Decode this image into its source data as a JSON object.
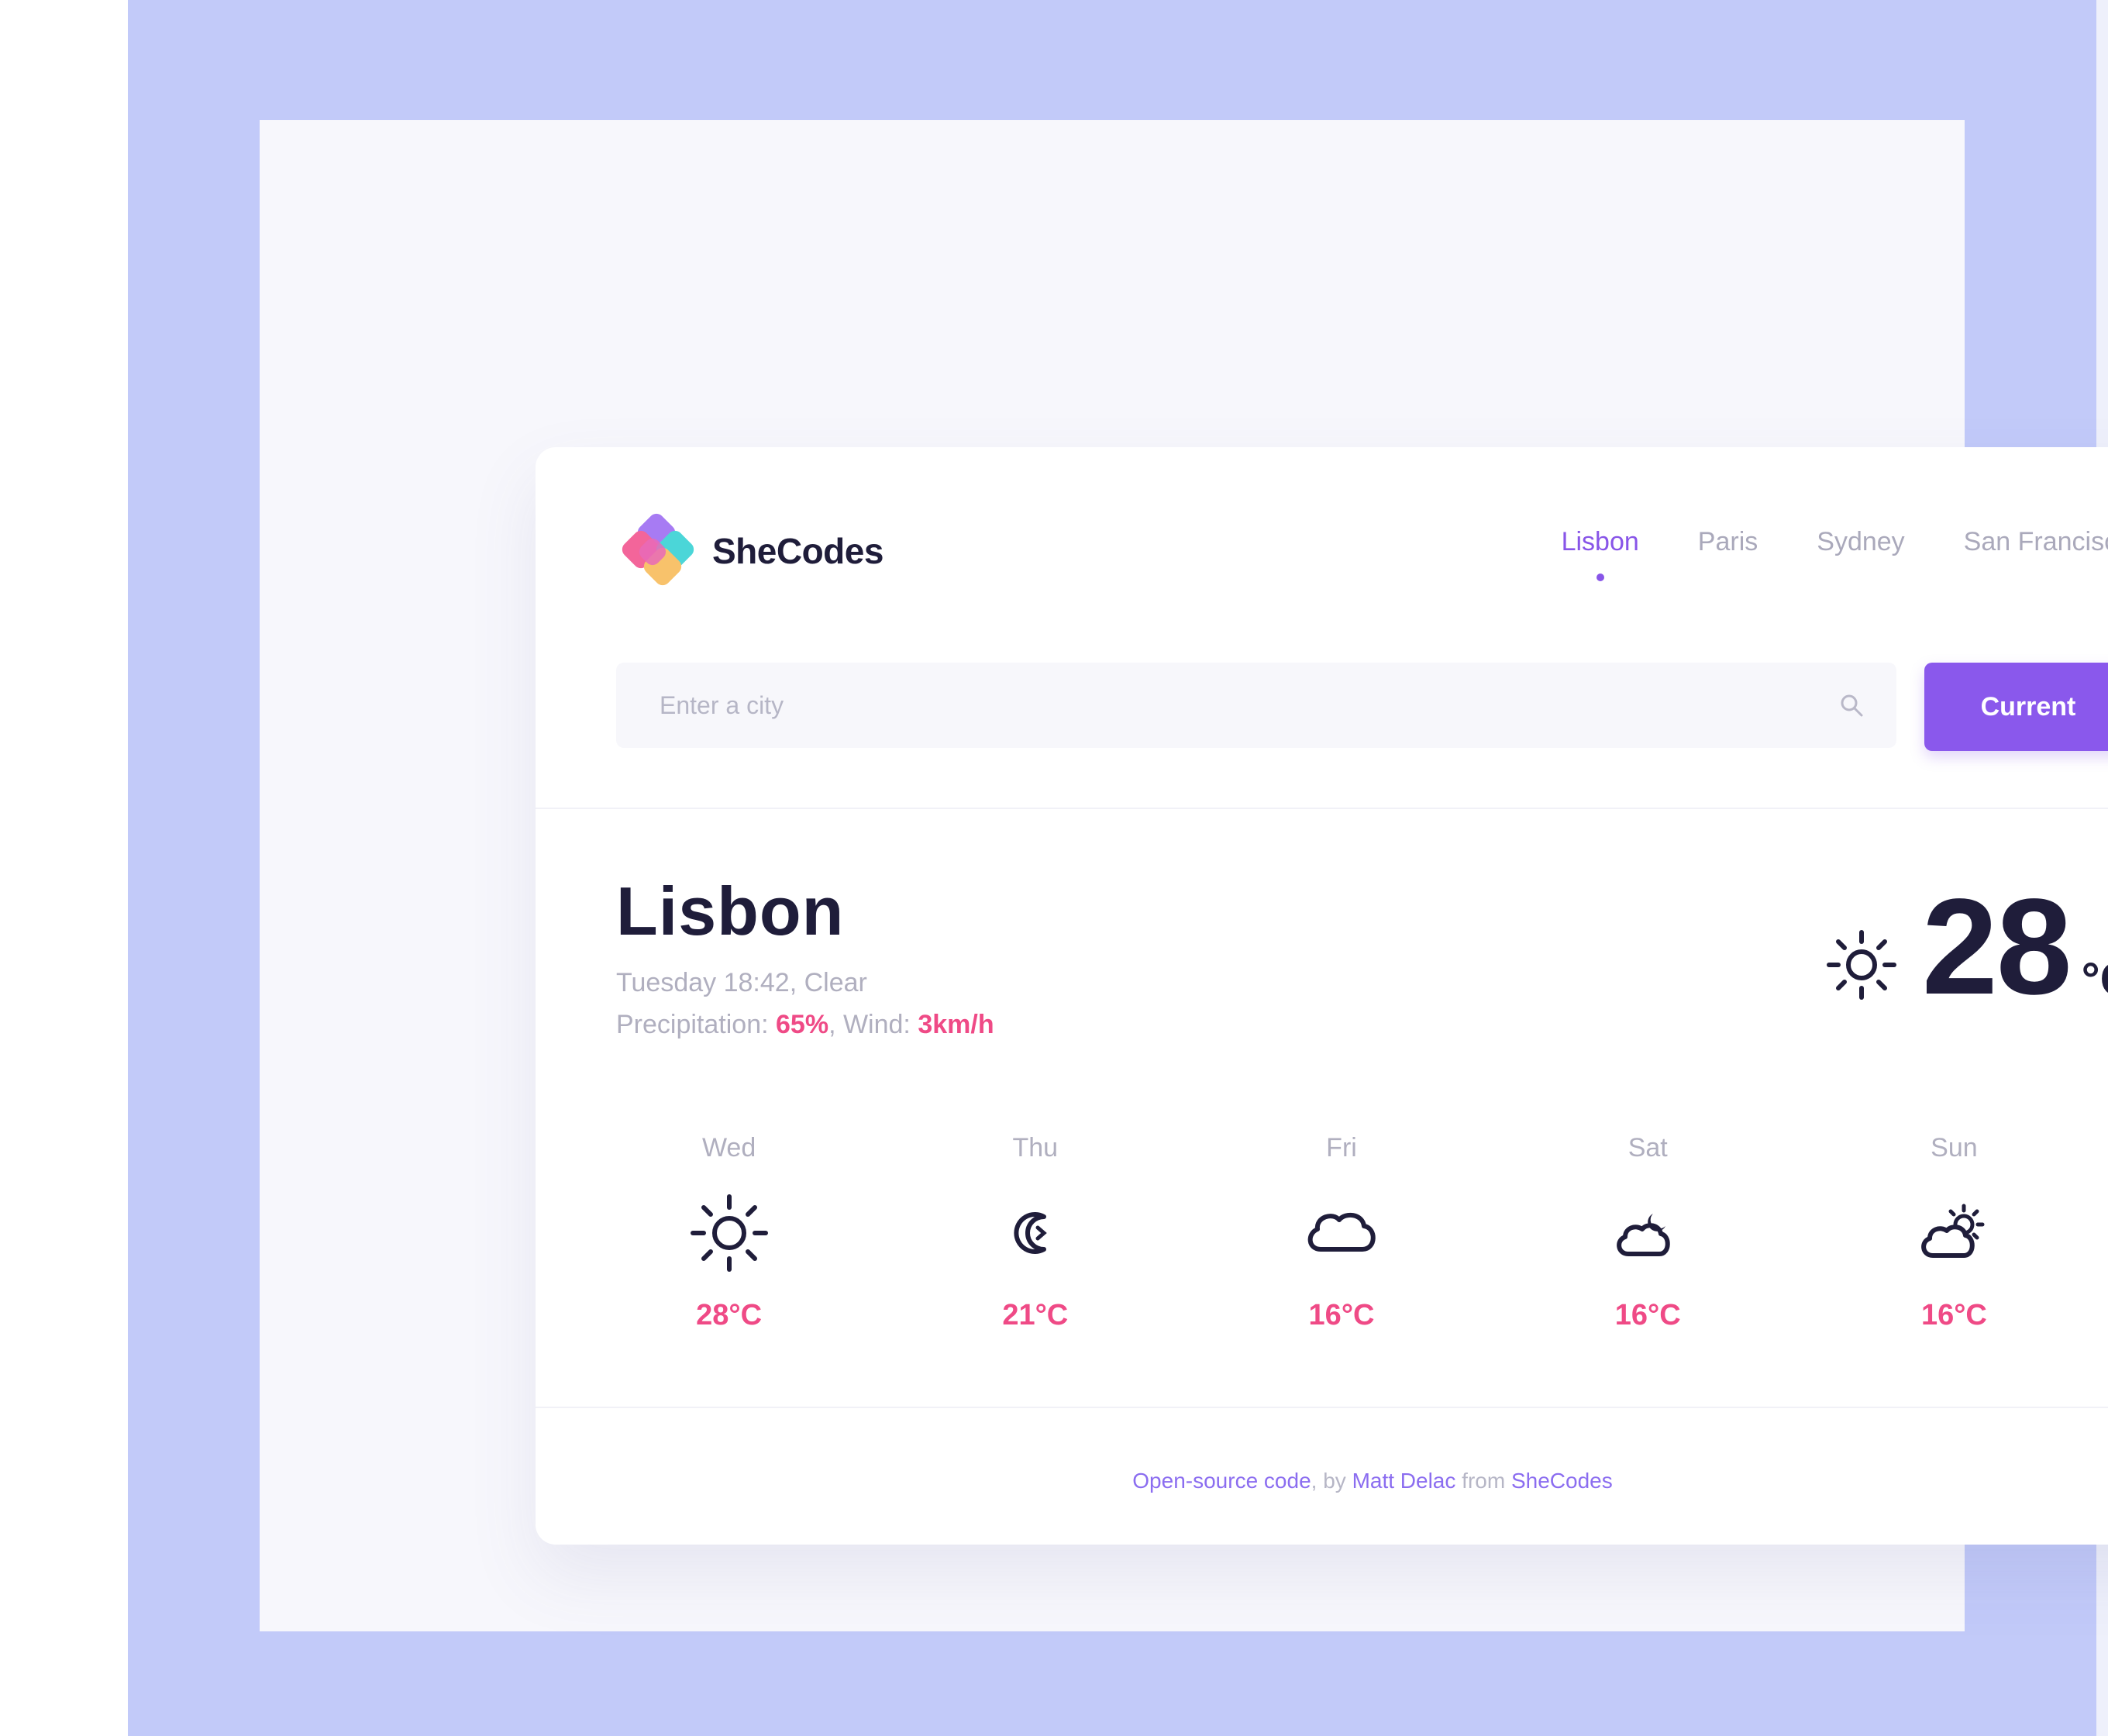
{
  "brand": {
    "name": "SheCodes",
    "colors": [
      "#f3659a",
      "#a77bf3",
      "#4bd6d8",
      "#f8c26b"
    ]
  },
  "nav": {
    "items": [
      {
        "label": "Lisbon",
        "active": true
      },
      {
        "label": "Paris",
        "active": false
      },
      {
        "label": "Sydney",
        "active": false
      },
      {
        "label": "San Francisco",
        "active": false
      }
    ]
  },
  "search": {
    "placeholder": "Enter a city",
    "value": ""
  },
  "current_button": {
    "label": "Current"
  },
  "weather": {
    "city": "Lisbon",
    "datetime": "Tuesday 18:42",
    "condition": "Clear",
    "precipitation_label": "Precipitation:",
    "precipitation": "65%",
    "wind_label": "Wind:",
    "wind": "3km/h",
    "temperature": "28",
    "unit": "°C",
    "icon": "sun-icon"
  },
  "forecast": [
    {
      "day": "Wed",
      "icon": "sun-icon",
      "temp": "28°C"
    },
    {
      "day": "Thu",
      "icon": "moon-icon",
      "temp": "21°C"
    },
    {
      "day": "Fri",
      "icon": "cloud-icon",
      "temp": "16°C"
    },
    {
      "day": "Sat",
      "icon": "cloud-moon-icon",
      "temp": "16°C"
    },
    {
      "day": "Sun",
      "icon": "cloud-sun-icon",
      "temp": "16°C"
    }
  ],
  "footer": {
    "code_link": "Open-source code",
    "by_text": ", by",
    "author_link": "Matt Delac",
    "from_text": "from",
    "org_link": "SheCodes"
  },
  "colors": {
    "background": "#c2caf9",
    "accent": "#8a58ec",
    "highlight": "#ef4a86",
    "text_dark": "#1f1d3a",
    "text_muted": "#b0afbf"
  }
}
